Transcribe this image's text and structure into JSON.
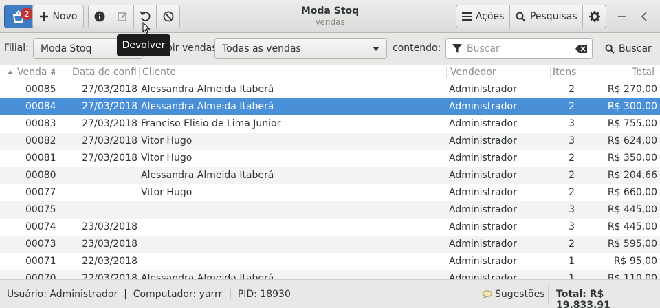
{
  "header": {
    "badge_count": "2",
    "new_label": "Novo",
    "title": "Moda Stoq",
    "subtitle": "Vendas",
    "actions_label": "Ações",
    "searches_label": "Pesquisas",
    "icons": [
      "basket-icon",
      "plus-icon",
      "info-icon",
      "edit-icon",
      "undo-icon",
      "cancel-icon",
      "menu-icon",
      "search-icon",
      "gear-icon",
      "minimize-icon",
      "back-chevron-icon"
    ]
  },
  "tooltip": "Devolver",
  "filters": {
    "branch_label": "Filial:",
    "branch_value": "Moda Stoq",
    "show_label": "Exibir vendas",
    "show_value": "Todas as vendas",
    "contains_label": "contendo:",
    "search_placeholder": "Buscar",
    "search_button": "Buscar"
  },
  "table": {
    "columns": [
      "Venda #",
      "Data de confirmação",
      "Cliente",
      "Vendedor",
      "Itens",
      "Total"
    ],
    "columns_visible": [
      "Venda #",
      "Data de confi",
      "Cliente",
      "Vendedor",
      "Itens",
      "Total"
    ],
    "sort_column": "Venda #",
    "rows": [
      {
        "venda": "00085",
        "data": "27/03/2018",
        "cliente": "Alessandra Almeida Itaberá",
        "vendedor": "Administrador",
        "itens": "2",
        "total": "R$ 270,00"
      },
      {
        "venda": "00084",
        "data": "27/03/2018",
        "cliente": "Alessandra Almeida Itaberá",
        "vendedor": "Administrador",
        "itens": "2",
        "total": "R$ 300,00"
      },
      {
        "venda": "00083",
        "data": "27/03/2018",
        "cliente": "Franciso Elisio de Lima Junior",
        "vendedor": "Administrador",
        "itens": "3",
        "total": "R$ 755,00"
      },
      {
        "venda": "00082",
        "data": "27/03/2018",
        "cliente": "Vitor Hugo",
        "vendedor": "Administrador",
        "itens": "3",
        "total": "R$ 624,00"
      },
      {
        "venda": "00081",
        "data": "27/03/2018",
        "cliente": "Vitor Hugo",
        "vendedor": "Administrador",
        "itens": "2",
        "total": "R$ 350,00"
      },
      {
        "venda": "00080",
        "data": "",
        "cliente": "Alessandra Almeida Itaberá",
        "vendedor": "Administrador",
        "itens": "2",
        "total": "R$ 204,66"
      },
      {
        "venda": "00077",
        "data": "",
        "cliente": "Vitor Hugo",
        "vendedor": "Administrador",
        "itens": "2",
        "total": "R$ 660,00"
      },
      {
        "venda": "00075",
        "data": "",
        "cliente": "",
        "vendedor": "Administrador",
        "itens": "3",
        "total": "R$ 445,00"
      },
      {
        "venda": "00074",
        "data": "23/03/2018",
        "cliente": "",
        "vendedor": "Administrador",
        "itens": "3",
        "total": "R$ 445,00"
      },
      {
        "venda": "00073",
        "data": "23/03/2018",
        "cliente": "",
        "vendedor": "Administrador",
        "itens": "2",
        "total": "R$ 595,00"
      },
      {
        "venda": "00071",
        "data": "22/03/2018",
        "cliente": "",
        "vendedor": "Administrador",
        "itens": "1",
        "total": "R$ 95,00"
      },
      {
        "venda": "00070",
        "data": "22/03/2018",
        "cliente": "Alessandra Almeida Itaberá",
        "vendedor": "Administrador",
        "itens": "1",
        "total": "R$ 110,00"
      }
    ],
    "selected_row": 1
  },
  "status": {
    "text": "Usuário: Administrador  |  Computador: yarrr  |  PID: 18930",
    "suggestions": "Sugestões",
    "total": "Total: R$ 19.833,91"
  },
  "colors": {
    "accent": "#4a90d9",
    "new_button": "#3f7cc4",
    "badge": "#c53434"
  }
}
